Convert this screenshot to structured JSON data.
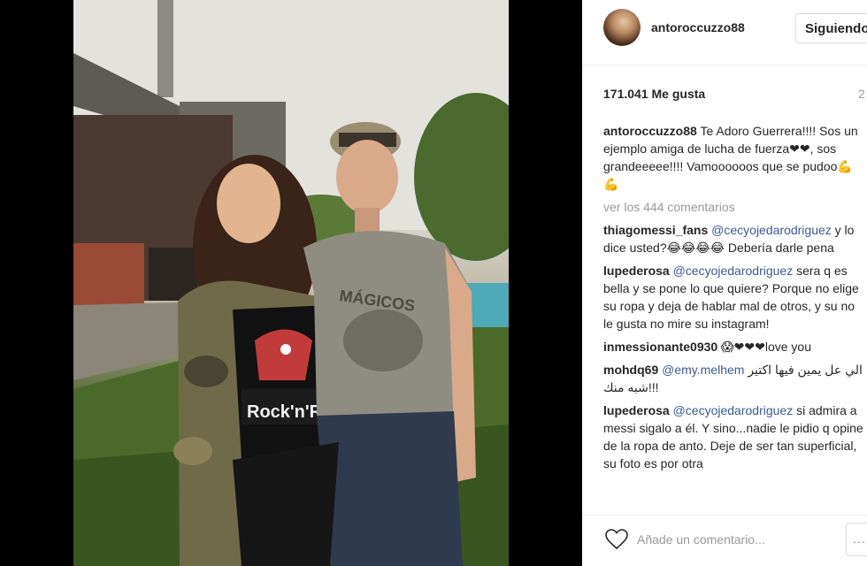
{
  "post": {
    "username": "antoroccuzzo88",
    "follow_label": "Siguiendo",
    "likes": "171.041 Me gusta",
    "time": "2",
    "view_more": "ver los 444 comentarios"
  },
  "comments": [
    {
      "author": "antoroccuzzo88",
      "mention": "",
      "text": " Te Adoro Guerrera!!!! Sos un ejemplo amiga de lucha de fuerza❤❤, sos grandeeeee!!!! Vamoooooos que se pudoo💪💪"
    },
    {
      "author": "thiagomessi_fans",
      "mention": "@cecyojedarodriguez",
      "text": " y lo dice usted?😂😂😂😂 Debería darle pena"
    },
    {
      "author": "lupederosa",
      "mention": "@cecyojedarodriguez",
      "text": " sera q es bella y se pone lo que quiere? Porque no elige su ropa y deja de hablar mal de otros, y su no le gusta no mire su instagram!"
    },
    {
      "author": "inmessionante0930",
      "mention": "",
      "text": " 😱❤❤❤love you"
    },
    {
      "author": "mohdq69",
      "mention": "@emy.melhem",
      "text": " الي عل يمين فيها اكتير شبه منك!!!"
    },
    {
      "author": "lupederosa",
      "mention": "@cecyojedarodriguez",
      "text": " si admira a messi sigalo a él. Y sino...nadie le pidio q opine de la ropa de anto. Deje de ser tan superficial, su foto es por otra"
    }
  ],
  "add_comment": {
    "placeholder": "Añade un comentario...",
    "more_label": "…"
  },
  "photo": {
    "shirt_text_1": "MÁGICOS",
    "shirt_text_2": "Rock'n'Roll"
  },
  "colors": {
    "mention": "#3b5998",
    "muted": "#999999",
    "border": "#dbdbdb"
  },
  "icons": [
    "heart-icon",
    "more-icon"
  ]
}
